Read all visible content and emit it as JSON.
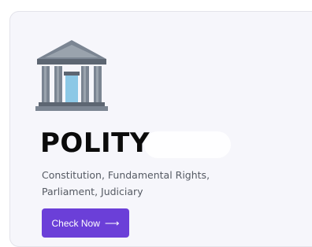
{
  "card": {
    "title": "POLITY",
    "description_lines": [
      "Constitution, Fundamental Rights,",
      "Parliament, Judiciary"
    ],
    "cta_label": "Check Now",
    "cta_icon": "arrow-right-icon",
    "icon": "government-building-icon",
    "colors": {
      "accent": "#6b3fd8",
      "icon_gray": "#7b8592",
      "icon_dark": "#5d6672",
      "door_blue": "#8cc8e6"
    }
  }
}
